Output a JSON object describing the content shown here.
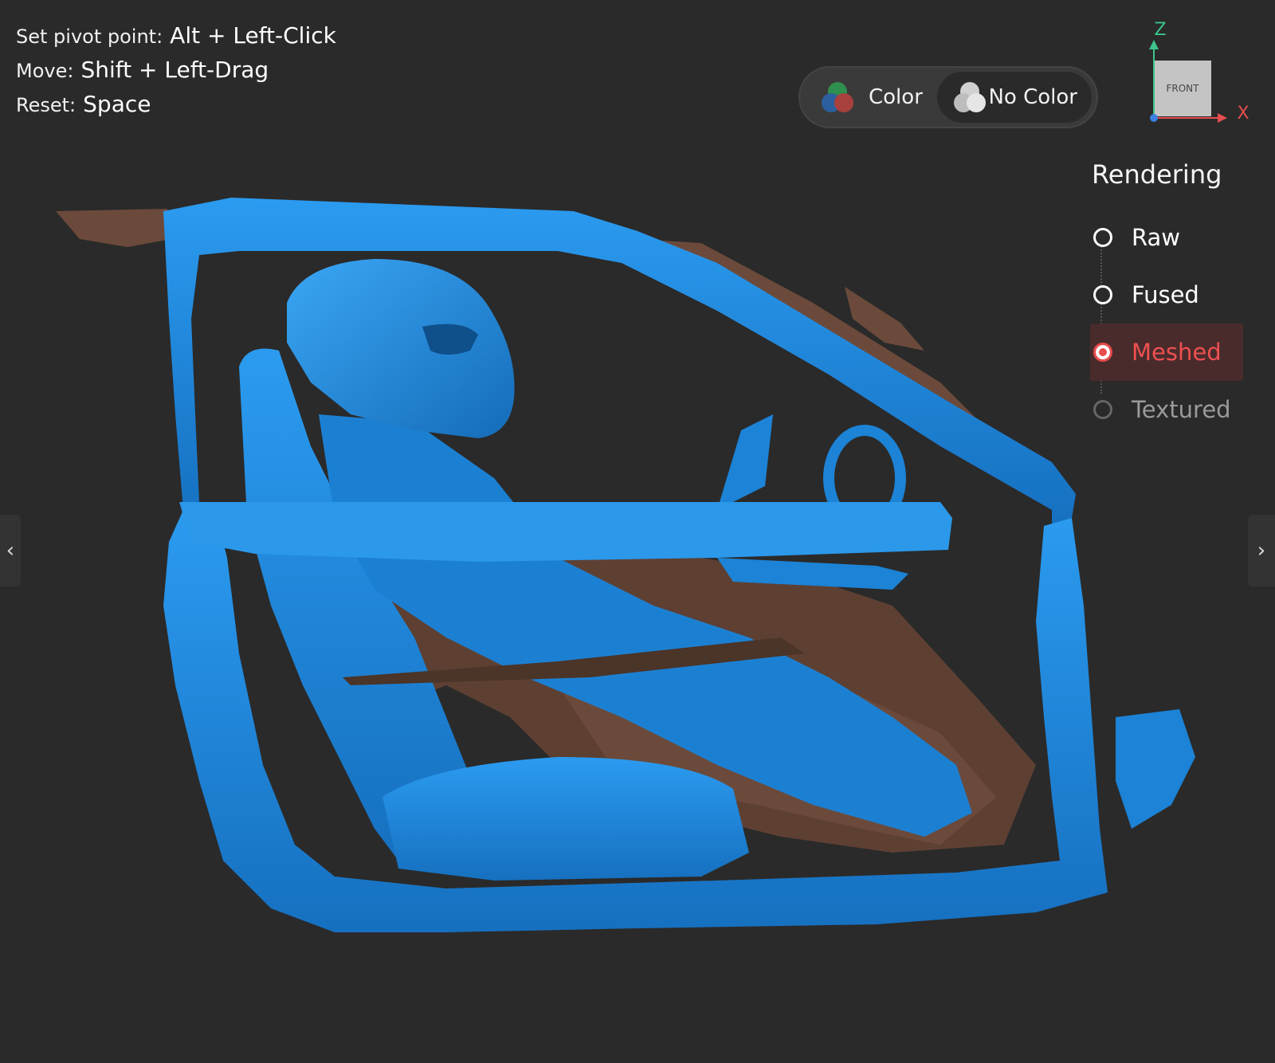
{
  "help": [
    {
      "label": "Set pivot point:",
      "key": "Alt + Left-Click"
    },
    {
      "label": "Move:",
      "key": "Shift + Left-Drag"
    },
    {
      "label": "Reset:",
      "key": "Space"
    }
  ],
  "color_toggle": {
    "options": [
      {
        "label": "Color",
        "selected": false
      },
      {
        "label": "No Color",
        "selected": true
      }
    ]
  },
  "gizmo": {
    "z_label": "Z",
    "x_label": "X",
    "face_label": "FRONT"
  },
  "rendering": {
    "title": "Rendering",
    "options": [
      {
        "label": "Raw",
        "state": "unselected"
      },
      {
        "label": "Fused",
        "state": "unselected"
      },
      {
        "label": "Meshed",
        "state": "selected"
      },
      {
        "label": "Textured",
        "state": "disabled"
      }
    ]
  },
  "nav": {
    "prev_icon": "chevron-left-icon",
    "next_icon": "chevron-right-icon"
  },
  "colors": {
    "background": "#2a2a2a",
    "mesh_blue": "#1c83d6",
    "mesh_brown": "#6b4a3b",
    "accent_red": "#e84b4b",
    "axis_z": "#3cc48b",
    "axis_x": "#e54e4e"
  }
}
